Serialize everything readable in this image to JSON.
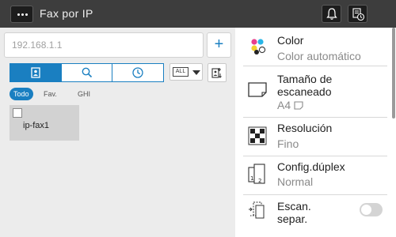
{
  "header": {
    "title": "Fax por IP",
    "menu_icon": "more-dots-icon",
    "notification_icon": "bell-icon",
    "job_status_icon": "job-status-icon"
  },
  "address": {
    "placeholder": "192.168.1.1",
    "value": "",
    "add_label": "+"
  },
  "view_tabs": [
    {
      "icon": "address-book-icon",
      "active": true
    },
    {
      "icon": "search-icon",
      "active": false
    },
    {
      "icon": "clock-icon",
      "active": false
    }
  ],
  "all_dropdown": {
    "label": "ALL"
  },
  "filters": [
    {
      "label": "Todo",
      "active": true
    },
    {
      "label": "Fav.",
      "active": false
    },
    {
      "label": "GHI",
      "active": false
    }
  ],
  "destinations": [
    {
      "name": "ip-fax1",
      "checked": false
    }
  ],
  "settings": [
    {
      "label": "Color",
      "value": "Color  automático",
      "icon": "color-dots-icon"
    },
    {
      "label": "Tamaño de escaneado",
      "value": "A4",
      "icon": "paper-size-icon"
    },
    {
      "label": "Resolución",
      "value": "Fino",
      "icon": "resolution-checker-icon"
    },
    {
      "label": "Config.dúplex",
      "value": "Normal",
      "icon": "duplex-icon"
    },
    {
      "label": "Escan. separ.",
      "toggle": false,
      "icon": "separate-scan-icon"
    }
  ],
  "colors": {
    "accent": "#1a7fc1",
    "topbar": "#3d3d3d",
    "left_pane": "#ececec"
  }
}
